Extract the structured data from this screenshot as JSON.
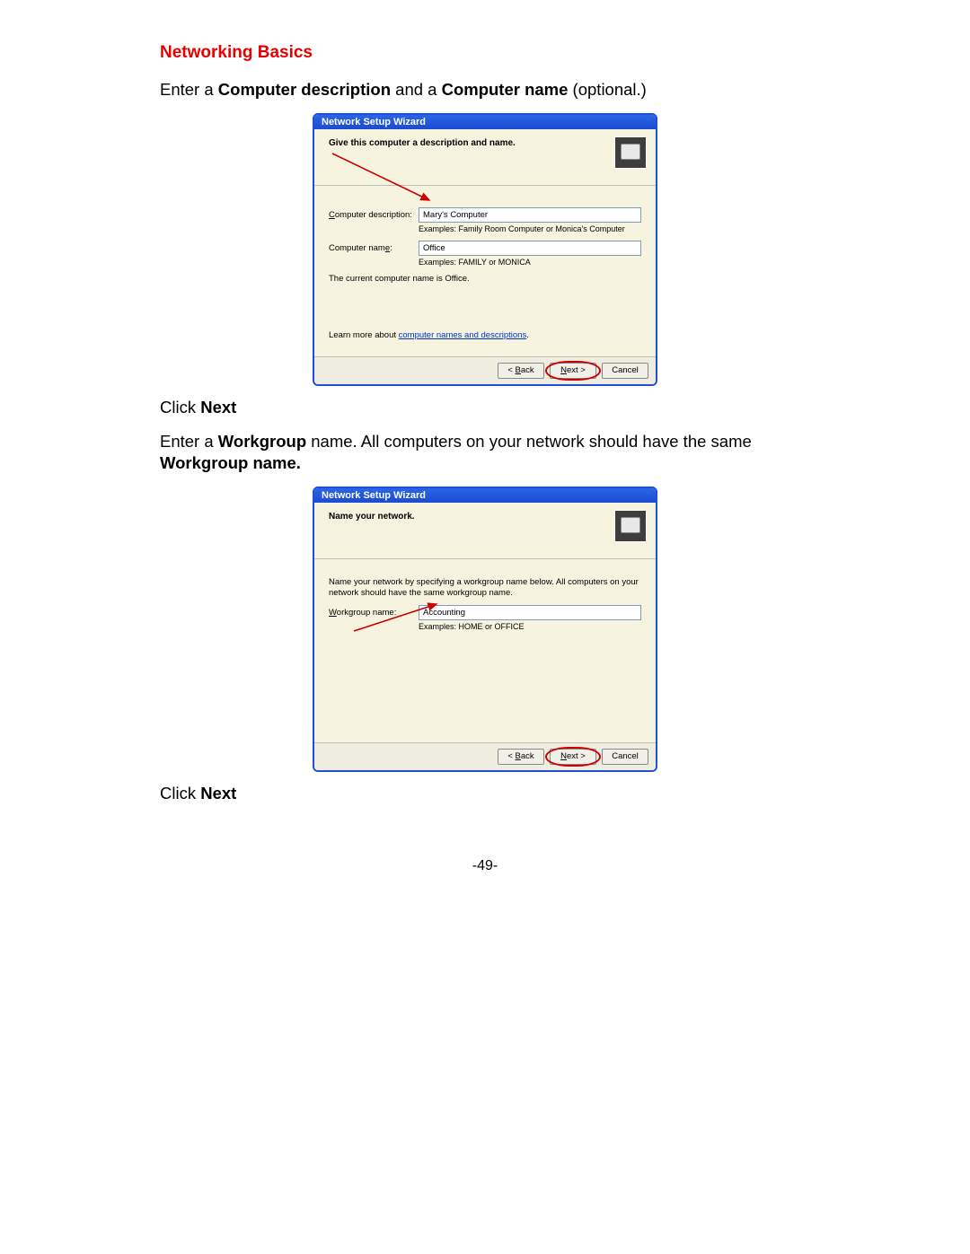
{
  "page": {
    "section_title": "Networking Basics",
    "page_number": "-49-"
  },
  "instr1": {
    "pre": "Enter a ",
    "b1": "Computer description",
    "mid": " and a ",
    "b2": "Computer name",
    "post": " (optional.)"
  },
  "wizard1": {
    "title": "Network Setup Wizard",
    "heading": "Give this computer a description and name.",
    "desc_label_pre": "C",
    "desc_label_post": "omputer description:",
    "desc_value": "Mary's Computer",
    "desc_example": "Examples: Family Room Computer or Monica's Computer",
    "name_label_pre": "Computer nam",
    "name_label_u": "e",
    "name_label_post": ":",
    "name_value": "Office",
    "name_example": "Examples: FAMILY or MONICA",
    "current_pre": "The current computer name is ",
    "current_val": "Office.",
    "learn_pre": "Learn more about ",
    "learn_link": "computer names and descriptions",
    "learn_post": ".",
    "btn_back_lt": "< ",
    "btn_back_u": "B",
    "btn_back_rest": "ack",
    "btn_next_u": "N",
    "btn_next_rest": "ext >",
    "btn_cancel": "Cancel"
  },
  "after1": {
    "click": "Click ",
    "next": "Next"
  },
  "instr2": {
    "pre": "Enter a ",
    "b1": "Workgroup",
    "mid": " name.    All computers on your network should have the same ",
    "b2": "Workgroup name."
  },
  "wizard2": {
    "title": "Network Setup Wizard",
    "heading": "Name your network.",
    "intro": "Name your network by specifying a workgroup name below. All computers on your network should have the same workgroup name.",
    "wg_label_u": "W",
    "wg_label_rest": "orkgroup name:",
    "wg_value": "Accounting",
    "wg_example": "Examples: HOME or OFFICE",
    "btn_back_lt": "< ",
    "btn_back_u": "B",
    "btn_back_rest": "ack",
    "btn_next_u": "N",
    "btn_next_rest": "ext >",
    "btn_cancel": "Cancel"
  },
  "after2": {
    "click": "Click ",
    "next": "Next"
  }
}
